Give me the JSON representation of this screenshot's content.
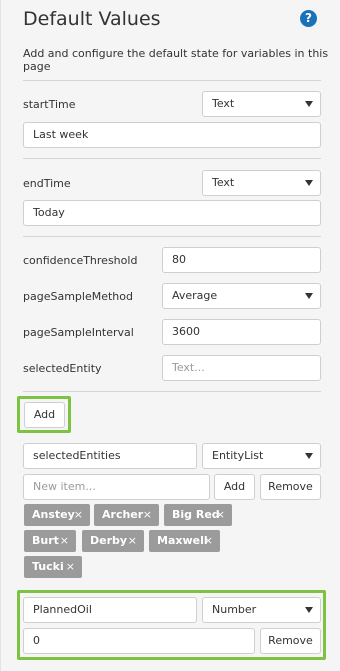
{
  "panel": {
    "title": "Default Values",
    "help_glyph": "?",
    "description": "Add and configure the default state for variables in this page"
  },
  "variables": {
    "startTime": {
      "label": "startTime",
      "type": "Text",
      "value": "Last week"
    },
    "endTime": {
      "label": "endTime",
      "type": "Text",
      "value": "Today"
    },
    "confidenceThreshold": {
      "label": "confidenceThreshold",
      "value": "80"
    },
    "pageSampleMethod": {
      "label": "pageSampleMethod",
      "value": "Average"
    },
    "pageSampleInterval": {
      "label": "pageSampleInterval",
      "value": "3600"
    },
    "selectedEntity": {
      "label": "selectedEntity",
      "placeholder": "Text..."
    }
  },
  "add_button": "Add",
  "entity_list": {
    "name": "selectedEntities",
    "type": "EntityList",
    "new_item_placeholder": "New item...",
    "add_label": "Add",
    "remove_label": "Remove",
    "items": [
      "Anstey",
      "Archer",
      "Big Red",
      "Burt",
      "Derby",
      "Maxwell",
      "Tucki"
    ],
    "remove_glyph": "×"
  },
  "new_variable": {
    "name": "PlannedOil",
    "type": "Number",
    "value": "0",
    "remove_label": "Remove"
  },
  "colors": {
    "highlight": "#7dc242",
    "help_icon": "#1a73b8",
    "tag_bg": "#9b9b9b"
  },
  "icons": [
    "help-icon",
    "chevron-down-icon",
    "close-icon"
  ]
}
